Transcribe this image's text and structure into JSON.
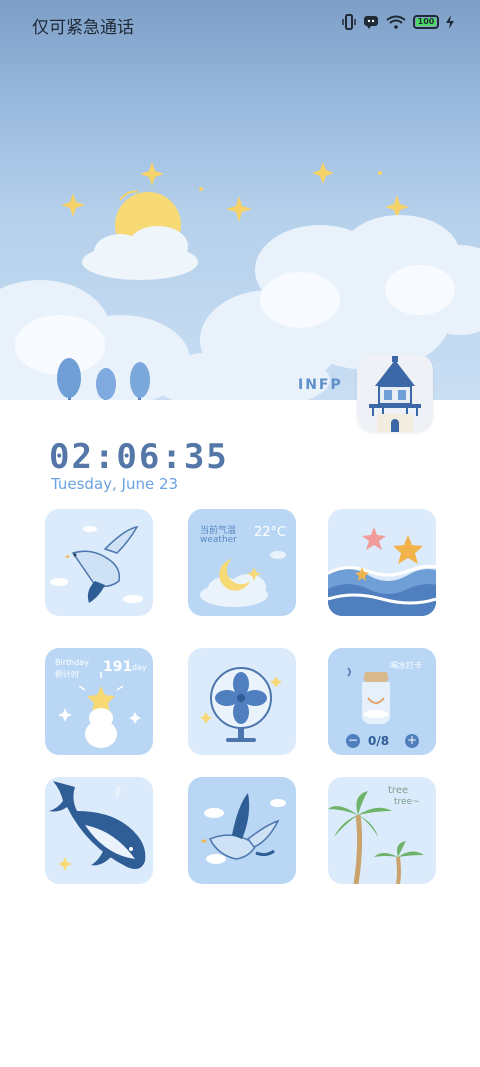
{
  "status_bar": {
    "carrier": "仅可紧急通话",
    "battery_level": "100"
  },
  "header": {
    "tag": "INFP"
  },
  "clock": {
    "time": "02:06:35",
    "date": "Tuesday, June 23"
  },
  "widgets": {
    "weather": {
      "title": "当前气温",
      "subtitle": "weather",
      "temperature": "22°C"
    },
    "birthday": {
      "title": "Birthday",
      "subtitle": "倒计时",
      "days": "191",
      "unit": "day"
    },
    "water": {
      "title": "喝水打卡",
      "counter": "0/8"
    },
    "tree": {
      "line1": "tree",
      "line2": "tree~"
    }
  },
  "colors": {
    "tile_bg_light": "#dcebfb",
    "tile_bg_mid": "#b9d7f5",
    "accent_blue": "#5577a8",
    "date_blue": "#6aa2e2"
  }
}
